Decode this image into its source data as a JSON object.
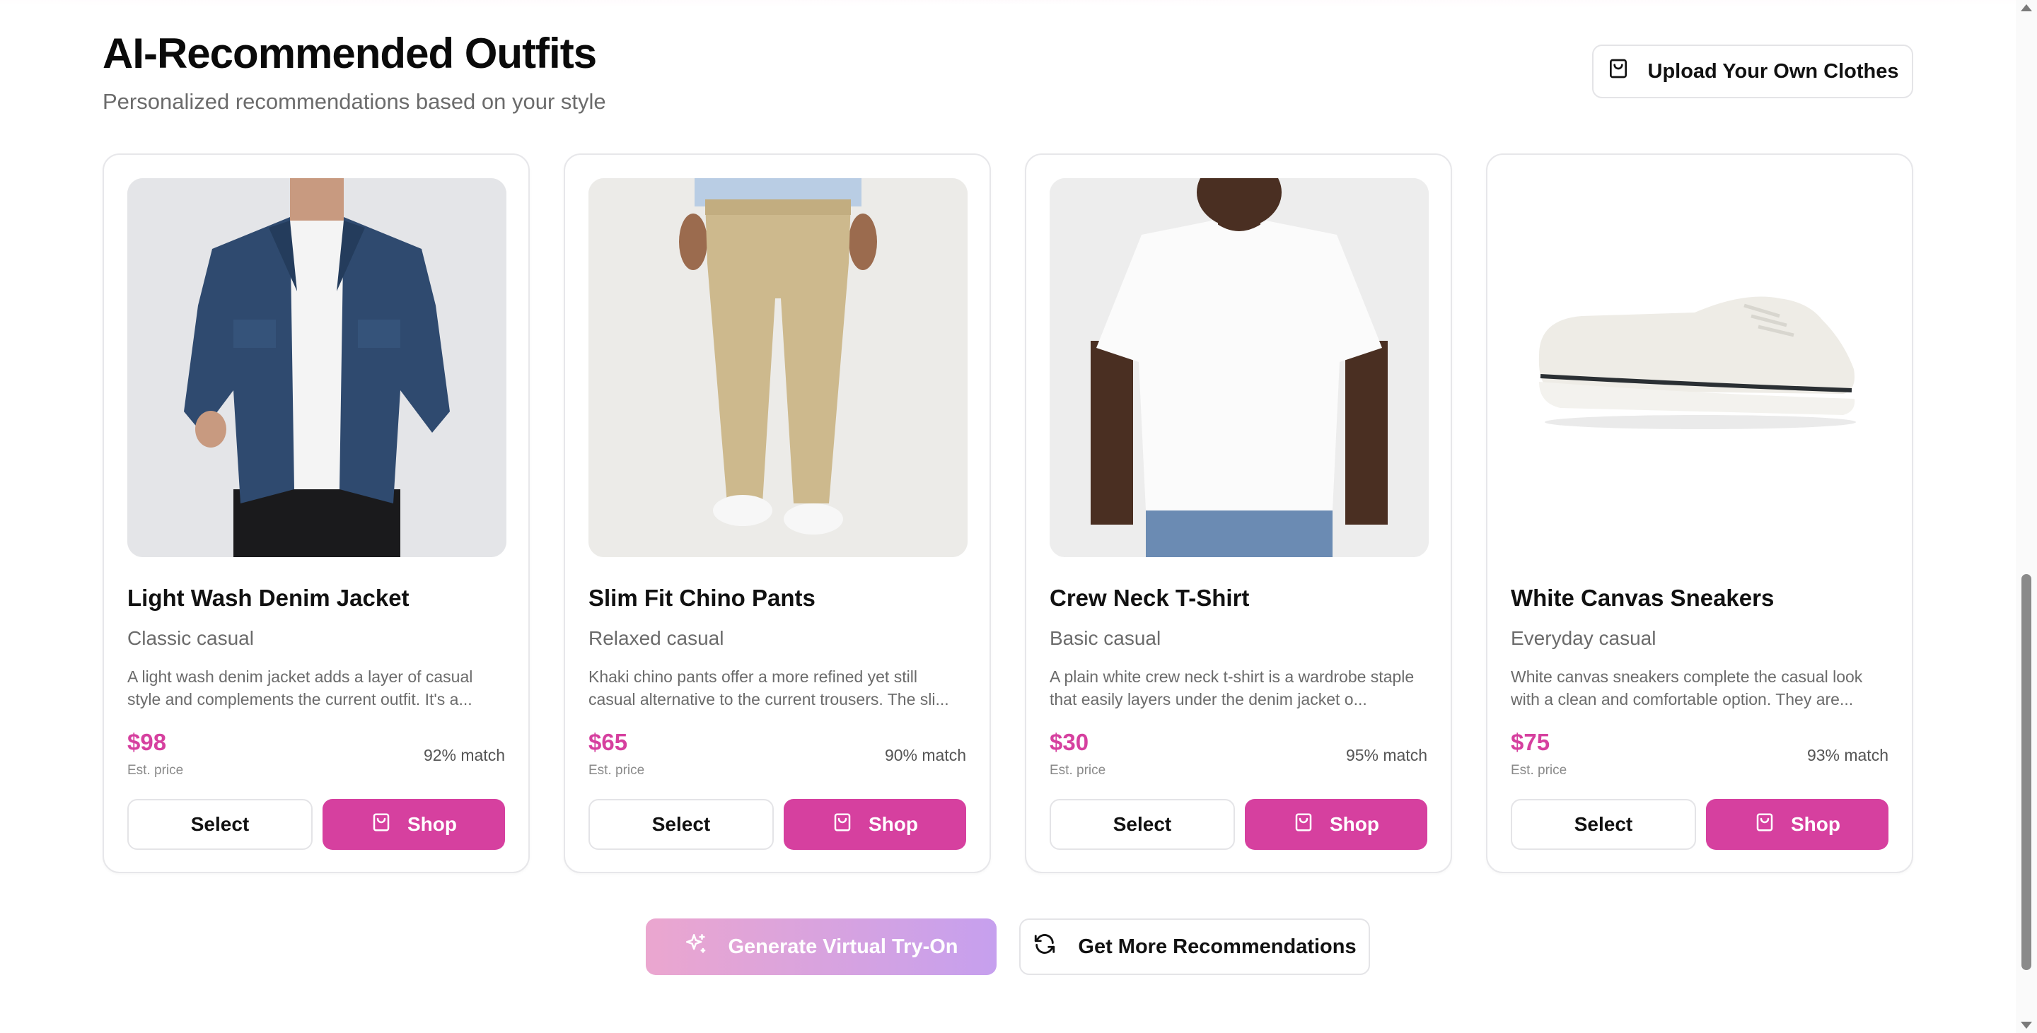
{
  "section": {
    "title": "AI-Recommended Outfits",
    "subtitle": "Personalized recommendations based on your style",
    "upload_button_label": "Upload Your Own Clothes",
    "upload_icon": "shopping-bag-icon"
  },
  "cards": [
    {
      "name": "Light Wash Denim Jacket",
      "style": "Classic casual",
      "description": "A light wash denim jacket adds a layer of casual style and complements the current outfit. It's a...",
      "price": "$98",
      "price_label": "Est. price",
      "match": "92% match",
      "select_label": "Select",
      "shop_label": "Shop",
      "image": "denim-jacket-photo"
    },
    {
      "name": "Slim Fit Chino Pants",
      "style": "Relaxed casual",
      "description": "Khaki chino pants offer a more refined yet still casual alternative to the current trousers. The sli...",
      "price": "$65",
      "price_label": "Est. price",
      "match": "90% match",
      "select_label": "Select",
      "shop_label": "Shop",
      "image": "chino-pants-photo"
    },
    {
      "name": "Crew Neck T-Shirt",
      "style": "Basic casual",
      "description": "A plain white crew neck t-shirt is a wardrobe staple that easily layers under the denim jacket o...",
      "price": "$30",
      "price_label": "Est. price",
      "match": "95% match",
      "select_label": "Select",
      "shop_label": "Shop",
      "image": "tshirt-photo"
    },
    {
      "name": "White Canvas Sneakers",
      "style": "Everyday casual",
      "description": "White canvas sneakers complete the casual look with a clean and comfortable option. They are...",
      "price": "$75",
      "price_label": "Est. price",
      "match": "93% match",
      "select_label": "Select",
      "shop_label": "Shop",
      "image": "sneakers-photo"
    }
  ],
  "actions": {
    "generate_label": "Generate Virtual Try-On",
    "generate_icon": "sparkles-icon",
    "more_label": "Get More Recommendations",
    "more_icon": "refresh-icon"
  },
  "colors": {
    "accent": "#d6409f",
    "gradient_start": "#eba6cf",
    "gradient_end": "#c6a0ee"
  }
}
